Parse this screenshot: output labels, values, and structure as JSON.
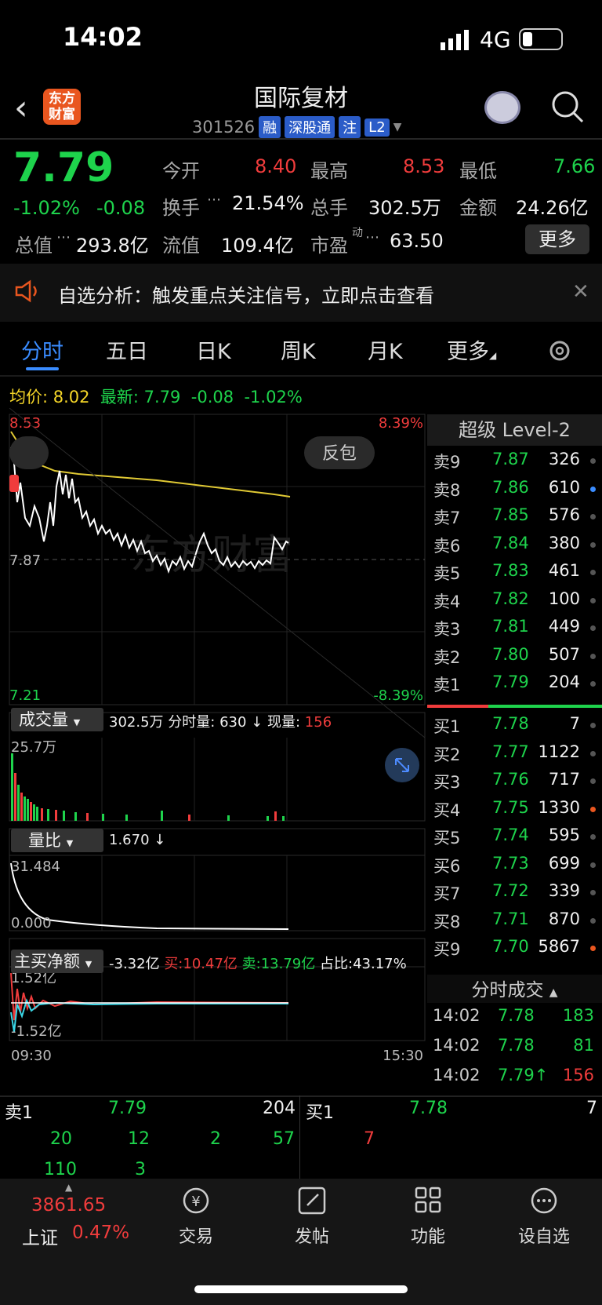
{
  "status": {
    "time": "14:02",
    "network": "4G"
  },
  "header": {
    "title": "国际复材",
    "code": "301526",
    "tags": [
      "融",
      "深股通",
      "注",
      "L2"
    ],
    "logo_text": "东方财富"
  },
  "quote": {
    "price": "7.79",
    "pct": "-1.02%",
    "chg": "-0.08",
    "open_label": "今开",
    "open": "8.40",
    "high_label": "最高",
    "high": "8.53",
    "low_label": "最低",
    "low": "7.66",
    "turnover_label": "换手",
    "turnover": "21.54%",
    "vol_label": "总手",
    "vol": "302.5万",
    "amount_label": "金额",
    "amount": "24.26亿",
    "mcap_label": "总值",
    "mcap": "293.8亿",
    "float_label": "流值",
    "float": "109.4亿",
    "pe_label": "市盈",
    "pe_sup": "动",
    "pe": "63.50",
    "more": "更多"
  },
  "alert": {
    "text": "自选分析：触发重点关注信号，立即点击查看"
  },
  "tabs": [
    "分时",
    "五日",
    "日K",
    "周K",
    "月K",
    "更多"
  ],
  "avg_line": {
    "avg_label": "均价:",
    "avg": "8.02",
    "latest_label": "最新:",
    "latest": "7.79",
    "chg": "-0.08",
    "pct": "-1.02%"
  },
  "chart": {
    "y_top": "8.53",
    "y_top_pct": "8.39%",
    "y_mid": "7.87",
    "y_bottom": "7.21",
    "y_bottom_pct": "-8.39%",
    "watermark": "东方财富",
    "reverse_btn": "反包",
    "vol_label": "成交量",
    "vol_total": "302.5万",
    "vol_min_label": "分时量:",
    "vol_min": "630 ↓",
    "vol_now_label": "现量:",
    "vol_now": "156",
    "vol_max": "25.7万",
    "qr_label": "量比",
    "qr_value": "1.670 ↓",
    "qr_top": "31.484",
    "qr_bottom": "0.000",
    "flow_label": "主买净额",
    "flow_net": "-3.32亿",
    "flow_buy": "买:10.47亿",
    "flow_sell": "卖:13.79亿",
    "flow_ratio": "占比:43.17%",
    "flow_top": "1.52亿",
    "flow_bottom": "-1.52亿",
    "time_start": "09:30",
    "time_end": "15:30"
  },
  "order_book": {
    "title": "超级 Level-2",
    "asks": [
      {
        "n": "卖9",
        "p": "7.87",
        "v": "326",
        "dot": "#555"
      },
      {
        "n": "卖8",
        "p": "7.86",
        "v": "610",
        "dot": "#3a8cff"
      },
      {
        "n": "卖7",
        "p": "7.85",
        "v": "576",
        "dot": "#555"
      },
      {
        "n": "卖6",
        "p": "7.84",
        "v": "380",
        "dot": "#555"
      },
      {
        "n": "卖5",
        "p": "7.83",
        "v": "461",
        "dot": "#555"
      },
      {
        "n": "卖4",
        "p": "7.82",
        "v": "100",
        "dot": "#555"
      },
      {
        "n": "卖3",
        "p": "7.81",
        "v": "449",
        "dot": "#555"
      },
      {
        "n": "卖2",
        "p": "7.80",
        "v": "507",
        "dot": "#555"
      },
      {
        "n": "卖1",
        "p": "7.79",
        "v": "204",
        "dot": "#555"
      }
    ],
    "bids": [
      {
        "n": "买1",
        "p": "7.78",
        "v": "7",
        "dot": "#555"
      },
      {
        "n": "买2",
        "p": "7.77",
        "v": "1122",
        "dot": "#555"
      },
      {
        "n": "买3",
        "p": "7.76",
        "v": "717",
        "dot": "#555"
      },
      {
        "n": "买4",
        "p": "7.75",
        "v": "1330",
        "dot": "#e9561f"
      },
      {
        "n": "买5",
        "p": "7.74",
        "v": "595",
        "dot": "#555"
      },
      {
        "n": "买6",
        "p": "7.73",
        "v": "699",
        "dot": "#555"
      },
      {
        "n": "买7",
        "p": "7.72",
        "v": "339",
        "dot": "#555"
      },
      {
        "n": "买8",
        "p": "7.71",
        "v": "870",
        "dot": "#555"
      },
      {
        "n": "买9",
        "p": "7.70",
        "v": "5867",
        "dot": "#e9561f"
      }
    ]
  },
  "ticks": {
    "title": "分时成交",
    "rows": [
      {
        "t": "14:02",
        "p": "7.78",
        "v": "183",
        "pc": "#1ed34c",
        "vc": "#1ed34c"
      },
      {
        "t": "14:02",
        "p": "7.78",
        "v": "81",
        "pc": "#1ed34c",
        "vc": "#1ed34c"
      },
      {
        "t": "14:02",
        "p": "7.79↑",
        "v": "156",
        "pc": "#1ed34c",
        "vc": "#f03c3c"
      }
    ]
  },
  "bottom_levels": {
    "sell_label": "卖1",
    "sell_price": "7.79",
    "sell_vol": "204",
    "buy_label": "买1",
    "buy_price": "7.78",
    "buy_vol": "7",
    "sell_queue": [
      "20",
      "12",
      "2",
      "57",
      "110",
      "3"
    ],
    "buy_queue": [
      "7"
    ]
  },
  "nav": {
    "index_value": "3861.65",
    "index_name": "上证",
    "index_pct": "0.47%",
    "items": [
      "交易",
      "发帖",
      "功能",
      "设自选"
    ]
  }
}
